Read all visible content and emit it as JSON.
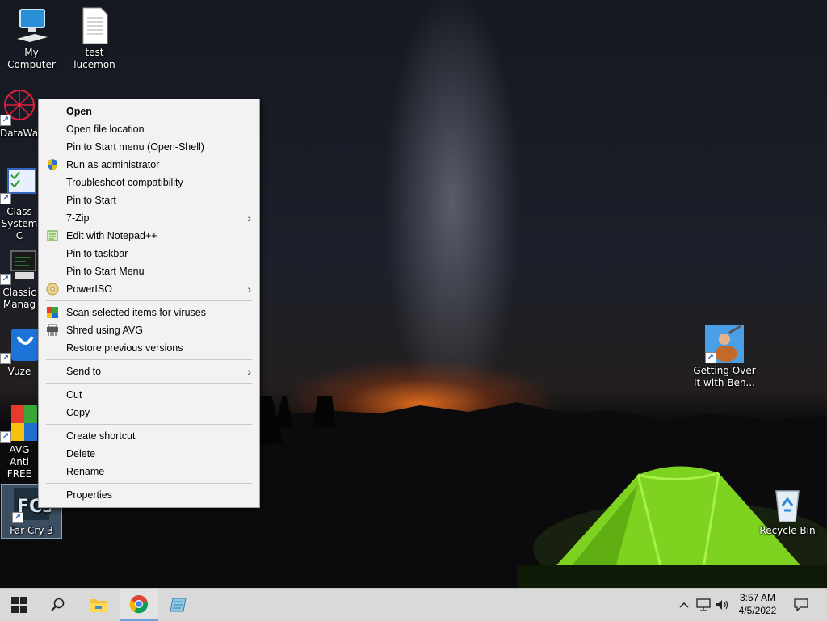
{
  "desktop": {
    "icons": [
      {
        "label": "My Computer"
      },
      {
        "label": "test lucemon"
      },
      {
        "label": "DataWag"
      },
      {
        "label": "Class System C"
      },
      {
        "label": "Classic Manag"
      },
      {
        "label": "Vuze"
      },
      {
        "label": "AVG Anti FREE"
      },
      {
        "label": "Far Cry 3"
      },
      {
        "label": "Getting Over It with Ben..."
      },
      {
        "label": "Recycle Bin"
      }
    ]
  },
  "context_menu": {
    "items": [
      {
        "label": "Open"
      },
      {
        "label": "Open file location"
      },
      {
        "label": "Pin to Start menu (Open-Shell)"
      },
      {
        "label": "Run as administrator"
      },
      {
        "label": "Troubleshoot compatibility"
      },
      {
        "label": "Pin to Start"
      },
      {
        "label": "7-Zip"
      },
      {
        "label": "Edit with Notepad++"
      },
      {
        "label": "Pin to taskbar"
      },
      {
        "label": "Pin to Start Menu"
      },
      {
        "label": "PowerISO"
      },
      {
        "label": "Scan selected items for viruses"
      },
      {
        "label": "Shred using AVG"
      },
      {
        "label": "Restore previous versions"
      },
      {
        "label": "Send to"
      },
      {
        "label": "Cut"
      },
      {
        "label": "Copy"
      },
      {
        "label": "Create shortcut"
      },
      {
        "label": "Delete"
      },
      {
        "label": "Rename"
      },
      {
        "label": "Properties"
      }
    ],
    "submenu_arrow": "›"
  },
  "taskbar": {
    "clock_time": "3:57 AM",
    "clock_date": "4/5/2022",
    "icons": [
      "windows-start-icon",
      "search-icon",
      "file-explorer-icon",
      "chrome-icon",
      "notepad-icon"
    ],
    "tray_icons": [
      "chevron-up-icon",
      "network-icon",
      "volume-icon",
      "notification-icon"
    ]
  },
  "colors": {
    "menu_bg": "#f2f2f2",
    "taskbar_bg": "#d9d9d9",
    "tent_green": "#7ed321",
    "glow_orange": "#ff7a1e"
  }
}
